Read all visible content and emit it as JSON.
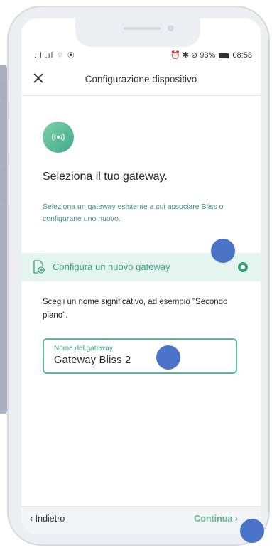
{
  "status_bar": {
    "left": ".ıl .ıl ⌔ ◉",
    "right_icons": "⏰ ✱ ⊘",
    "battery_percent": "93%",
    "time": "08:58"
  },
  "header": {
    "close_icon": "close-icon",
    "title": "Configurazione dispositivo"
  },
  "main": {
    "icon": "broadcast-icon",
    "title": "Seleziona il tuo gateway.",
    "description": "Seleziona un gateway esistente a cui associare Bliss o configurane uno nuovo."
  },
  "option": {
    "icon": "new-document-icon",
    "label": "Configura un nuovo gateway",
    "selected": true
  },
  "hint": "Scegli un nome significativo, ad esempio \"Secondo piano\".",
  "gateway_field": {
    "label": "Nome del gateway",
    "value": "Gateway Bliss 2"
  },
  "footer": {
    "back_label": "Indietro",
    "continue_label": "Continua"
  },
  "colors": {
    "accent": "#3aa27f",
    "option_bg": "#e4f4ef",
    "marker": "#4a74c8"
  }
}
